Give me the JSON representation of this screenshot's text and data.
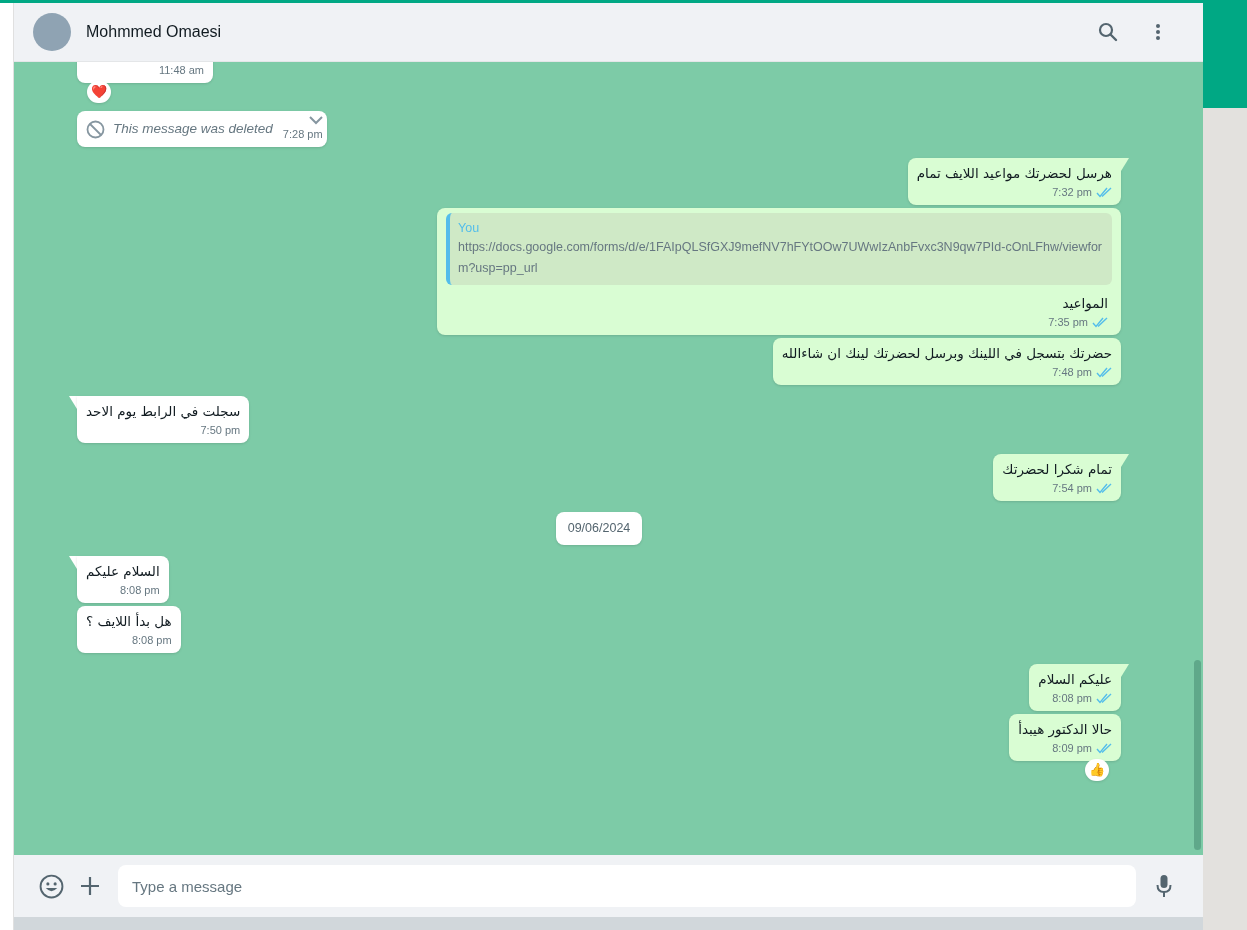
{
  "header": {
    "contact_name": "Mohmmed Omaesi"
  },
  "messages": [
    {
      "kind": "text",
      "outgoing": false,
      "tail": false,
      "time": "11:48 am",
      "reaction": "❤️"
    },
    {
      "kind": "deleted",
      "outgoing": false,
      "tail": false,
      "text": "This message was deleted",
      "time": "7:28 pm"
    },
    {
      "kind": "text",
      "outgoing": true,
      "tail": true,
      "text": "هرسل لحضرتك مواعيد اللايف تمام",
      "time": "7:32 pm",
      "read": true
    },
    {
      "kind": "quoted",
      "outgoing": true,
      "tail": false,
      "quote_author": "You",
      "quote_text": "https://docs.google.com/forms/d/e/1FAIpQLSfGXJ9mefNV7hFYtOOw7UWwIzAnbFvxc3N9qw7PId-cOnLFhw/viewform?usp=pp_url",
      "text": "المواعيد",
      "time": "7:35 pm",
      "read": true
    },
    {
      "kind": "text",
      "outgoing": true,
      "tail": false,
      "text": "حضرتك بتسجل في اللينك وبرسل لحضرتك لينك ان شاءالله",
      "time": "7:48 pm",
      "read": true
    },
    {
      "kind": "text",
      "outgoing": false,
      "tail": true,
      "text": "سجلت في الرابط يوم الاحد",
      "time": "7:50 pm"
    },
    {
      "kind": "text",
      "outgoing": true,
      "tail": true,
      "text": "تمام شكرا لحضرتك",
      "time": "7:54 pm",
      "read": true
    },
    {
      "kind": "date",
      "text": "09/06/2024"
    },
    {
      "kind": "text",
      "outgoing": false,
      "tail": true,
      "text": "السلام عليكم",
      "time": "8:08 pm"
    },
    {
      "kind": "text",
      "outgoing": false,
      "tail": false,
      "text": "هل بدأ اللايف ؟",
      "time": "8:08 pm"
    },
    {
      "kind": "text",
      "outgoing": true,
      "tail": true,
      "text": "عليكم السلام",
      "time": "8:08 pm",
      "read": true
    },
    {
      "kind": "text",
      "outgoing": true,
      "tail": false,
      "text": "حالا الدكتور هيبدأ",
      "time": "8:09 pm",
      "read": true,
      "reaction": "👍"
    }
  ],
  "composer": {
    "placeholder": "Type a message"
  }
}
